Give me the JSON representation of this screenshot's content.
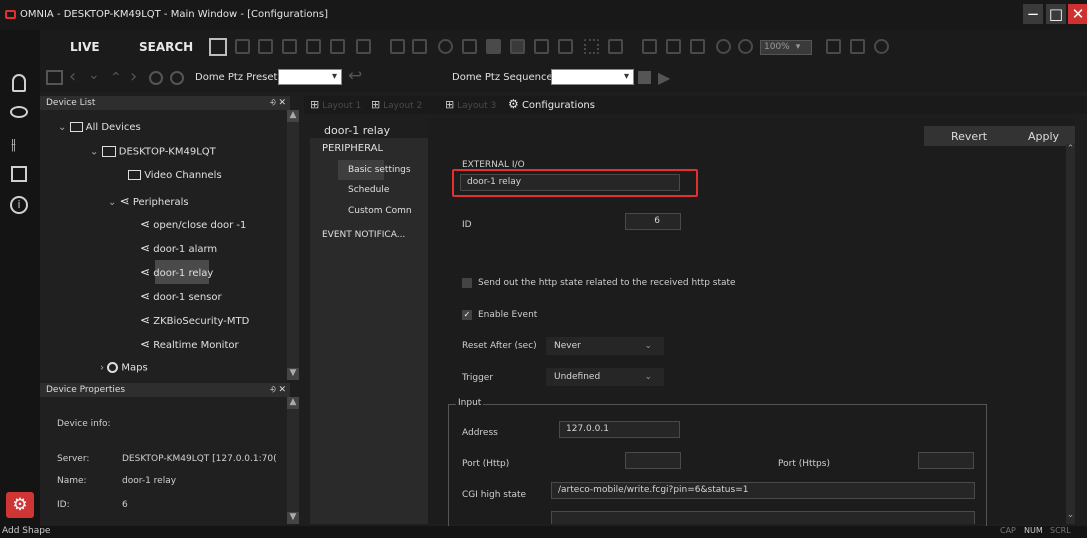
{
  "app": {
    "title": "OMNIA - DESKTOP-KM49LQT - Main Window - [Configurations]"
  },
  "window_controls": {
    "minimize": "−",
    "restore": "□",
    "close": "✕"
  },
  "toolbar": {
    "live": "LIVE",
    "search": "SEARCH",
    "zoom": "100%",
    "dome_ptz_preset": "Dome Ptz Preset",
    "dome_ptz_sequence": "Dome Ptz Sequence"
  },
  "tabs": {
    "layout1": "Layout 1",
    "layout2": "Layout 2",
    "layout3": "Layout 3",
    "configurations": "Configurations"
  },
  "device_list": {
    "title": "Device List",
    "pin": "⨮ ✕",
    "items": [
      "All Devices",
      "DESKTOP-KM49LQT",
      "Video Channels",
      "Peripherals",
      "open/close door -1",
      "door-1 alarm",
      "door-1 relay",
      "door-1 sensor",
      "ZKBioSecurity-MTD",
      "Realtime Monitor",
      "Maps"
    ]
  },
  "device_properties": {
    "title": "Device Properties",
    "pin": "⨮ ✕",
    "device_info_label": "Device info:",
    "server_label": "Server:",
    "server_value": "DESKTOP-KM49LQT [127.0.0.1:70(",
    "name_label": "Name:",
    "name_value": "door-1 relay",
    "id_label": "ID:",
    "id_value": "6"
  },
  "config_nav": {
    "header": "door-1 relay",
    "peripheral": "PERIPHERAL",
    "basic": "Basic settings",
    "schedule": "Schedule",
    "custom": "Custom Comn",
    "event": "EVENT NOTIFICA..."
  },
  "form": {
    "revert": "Revert",
    "apply": "Apply",
    "external_io_label": "EXTERNAL I/O",
    "external_io_value": "door-1 relay",
    "id_label": "ID",
    "id_value": "6",
    "http_state_label": "Send out the http state related to the received http state",
    "enable_event_label": "Enable Event",
    "reset_after_label": "Reset After (sec)",
    "reset_after_value": "Never",
    "trigger_label": "Trigger",
    "trigger_value": "Undefined",
    "input_group": "Input",
    "address_label": "Address",
    "address_value": "127.0.0.1",
    "port_http_label": "Port (Http)",
    "port_https_label": "Port (Https)",
    "cgi_high_label": "CGI high state",
    "cgi_high_value": "/arteco-mobile/write.fcgi?pin=6&status=1"
  },
  "status": {
    "left": "Add Shape",
    "cap": "CAP",
    "num": "NUM",
    "scrl": "SCRL"
  },
  "colors": {
    "accent": "#e03030",
    "dark": "#1e1e1e"
  }
}
